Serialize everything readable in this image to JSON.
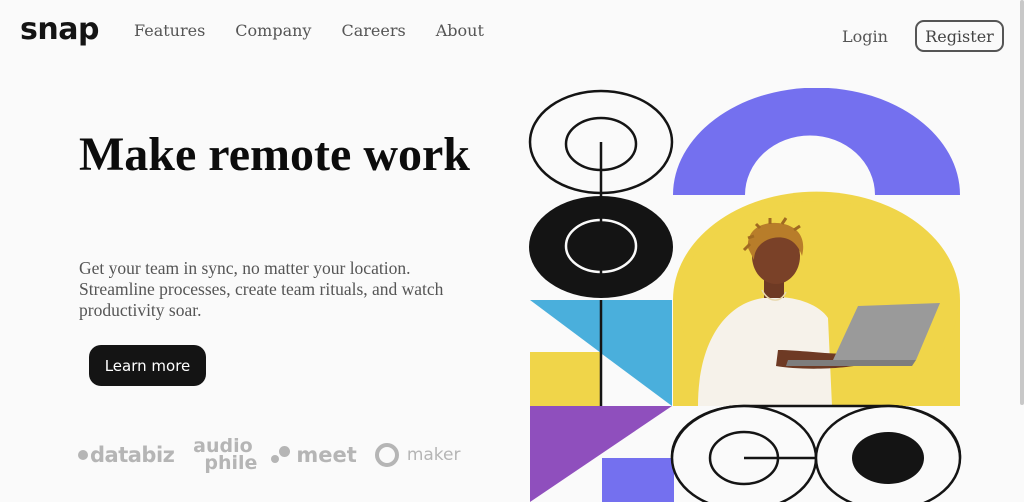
{
  "brand": {
    "name": "snap"
  },
  "nav": {
    "items": [
      {
        "label": "Features"
      },
      {
        "label": "Company"
      },
      {
        "label": "Careers"
      },
      {
        "label": "About"
      }
    ],
    "login_label": "Login",
    "register_label": "Register"
  },
  "hero": {
    "title": "Make remote work",
    "description": "Get your team in sync, no matter your location. Streamline processes, create team rituals, and watch productivity soar.",
    "cta_label": "Learn more"
  },
  "clients": {
    "databiz": "databiz",
    "audiophile_line1": "audio",
    "audiophile_line2": "phile",
    "meet": "meet",
    "maker": "maker"
  },
  "colors": {
    "accent_purple": "#7470ef",
    "accent_yellow": "#f0d549",
    "accent_blue": "#4aafdc",
    "accent_violet": "#8f4fbd",
    "dark": "#141414"
  }
}
